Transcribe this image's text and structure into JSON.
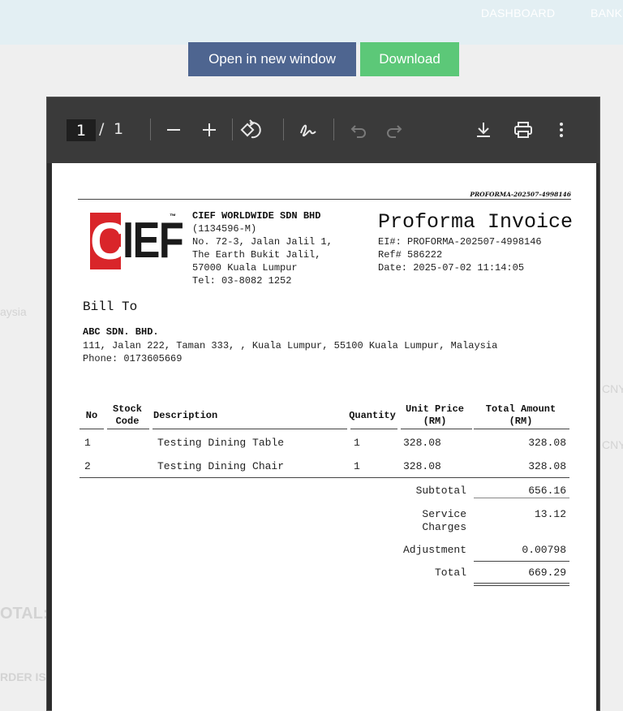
{
  "topbar": {
    "nav": [
      "DASHBOARD",
      "BANK"
    ]
  },
  "actions": {
    "open_label": "Open in new window",
    "download_label": "Download"
  },
  "background": {
    "left_text_1": "aysia",
    "left_total": "OTAL:",
    "left_order": "RDER IS",
    "right_text_1": "CNY",
    "right_text_2": "CNY"
  },
  "viewer": {
    "current_page": "1",
    "page_sep": "/",
    "total_pages": "1",
    "icons": [
      "zoom-out-icon",
      "zoom-in-icon",
      "rotate-icon",
      "draw-icon",
      "undo-icon",
      "redo-icon",
      "download-icon",
      "print-icon",
      "more-icon"
    ]
  },
  "doc": {
    "doc_id": "PROFORMA-202507-4998146",
    "company": {
      "name": "CIEF WORLDWIDE SDN BHD",
      "reg": "(1134596-M)",
      "addr1": "No. 72-3, Jalan Jalil 1,",
      "addr2": "The Earth Bukit Jalil,",
      "addr3": "57000 Kuala Lumpur",
      "tel": "Tel: 03-8082 1252",
      "logo_text": "CIEF"
    },
    "title": "Proforma Invoice",
    "ei": "EI#: PROFORMA-202507-4998146",
    "ref": "Ref# 586222",
    "date": "Date: 2025-07-02 11:14:05",
    "bill_to_label": "Bill To",
    "customer": {
      "name": "ABC SDN. BHD.",
      "address": "111, Jalan 222, Taman 333, , Kuala Lumpur, 55100 Kuala Lumpur, Malaysia",
      "phone": "Phone: 0173605669"
    },
    "table": {
      "headers": {
        "no": "No",
        "stock_code_1": "Stock",
        "stock_code_2": "Code",
        "description": "Description",
        "quantity": "Quantity",
        "unit_price_1": "Unit Price",
        "unit_price_2": "(RM)",
        "total_amount_1": "Total Amount",
        "total_amount_2": "(RM)"
      },
      "rows": [
        {
          "no": "1",
          "code": "",
          "description": "Testing Dining Table",
          "qty": "1",
          "unit": "328.08",
          "total": "328.08"
        },
        {
          "no": "2",
          "code": "",
          "description": "Testing Dining Chair",
          "qty": "1",
          "unit": "328.08",
          "total": "328.08"
        }
      ]
    },
    "summary": {
      "subtotal_label": "Subtotal",
      "subtotal": "656.16",
      "service_label_1": "Service",
      "service_label_2": "Charges",
      "service": "13.12",
      "adjustment_label": "Adjustment",
      "adjustment": "0.00798",
      "total_label": "Total",
      "total": "669.29"
    }
  }
}
